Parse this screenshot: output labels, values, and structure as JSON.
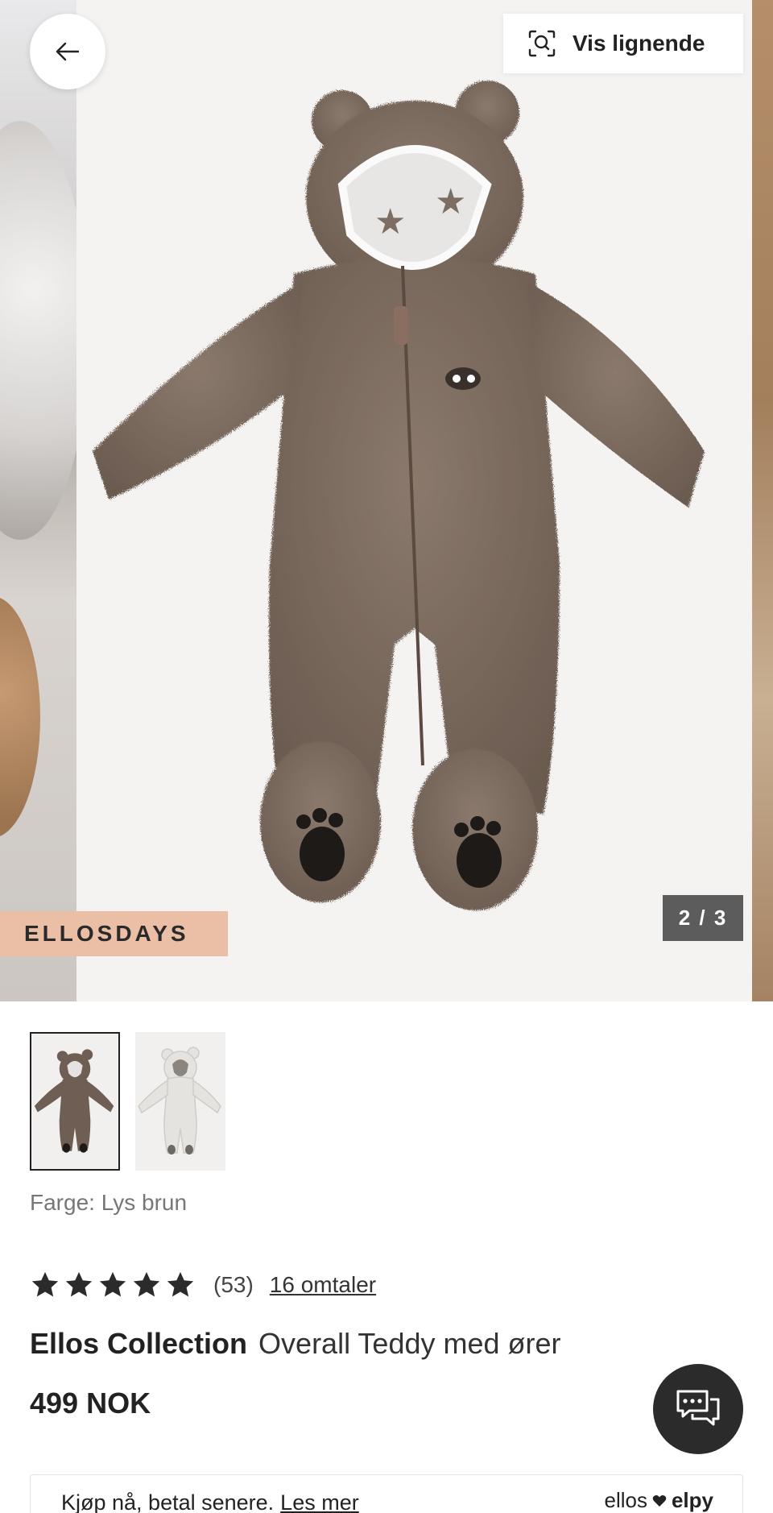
{
  "gallery": {
    "similar_button_label": "Vis lignende",
    "promo_tag": "ELLOSDAYS",
    "counter": "2 / 3",
    "product_image": "brown-teddy-overall-with-ears"
  },
  "icons": {
    "back": "arrow-left-icon",
    "similar": "scan-search-icon",
    "chat": "chat-bubbles-icon",
    "star": "star-icon",
    "heart": "heart-icon"
  },
  "thumbnails": [
    {
      "color": "brown",
      "selected": true
    },
    {
      "color": "white",
      "selected": false
    }
  ],
  "product": {
    "color_label": "Farge: Lys brun",
    "rating_value": 5,
    "rating_count": "(53)",
    "reviews_link": "16 omtaler",
    "brand": "Ellos Collection",
    "name": "Overall Teddy med ører",
    "price": "499 NOK"
  },
  "payment": {
    "text": "Kjøp nå, betal senere.",
    "link": "Les mer",
    "logo_left": "ellos",
    "logo_right": "elpy"
  },
  "colors": {
    "promo_bg": "#ebbea6",
    "counter_bg": "#5c5c5c",
    "chat_bg": "#2b2b2b",
    "teddy_brown": "#7b6a5e"
  }
}
